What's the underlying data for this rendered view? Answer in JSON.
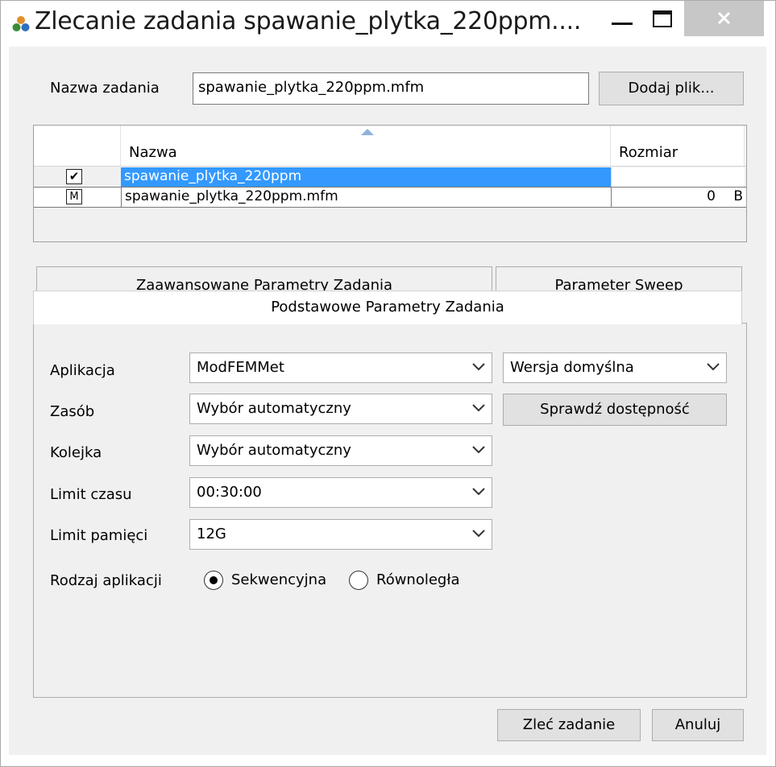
{
  "window": {
    "title": "Zlecanie zadania spawanie_plytka_220ppm....",
    "icon": "app-flower-icon",
    "controls": [
      "minimize-icon",
      "maximize-icon",
      "close-icon"
    ]
  },
  "job": {
    "name_label": "Nazwa zadania",
    "name_value": "spawanie_plytka_220ppm.mfm",
    "add_file_label": "Dodaj plik..."
  },
  "files": {
    "columns": {
      "name": "Nazwa",
      "size": "Rozmiar"
    },
    "sort_indicator": "sort-ascending-icon",
    "rows": [
      {
        "icon": "checkbox-checked-icon",
        "mark": "✔",
        "name": "spawanie_plytka_220ppm",
        "size": "",
        "unit": "",
        "selected": true
      },
      {
        "icon": "mfm-file-icon",
        "mark": "M",
        "name": "spawanie_plytka_220ppm.mfm",
        "size": "0",
        "unit": "B",
        "selected": false
      }
    ]
  },
  "tabs": {
    "advanced": "Zaawansowane Parametry Zadania",
    "sweep": "Parameter Sweep",
    "basic": "Podstawowe Parametry Zadania"
  },
  "form": {
    "application_label": "Aplikacja",
    "application_value": "ModFEMMet",
    "version_value": "Wersja domyślna",
    "resource_label": "Zasób",
    "resource_value": "Wybór automatyczny",
    "check_availability_label": "Sprawdź dostępność",
    "queue_label": "Kolejka",
    "queue_value": "Wybór automatyczny",
    "time_limit_label": "Limit czasu",
    "time_limit_value": "00:30:00",
    "memory_limit_label": "Limit pamięci",
    "memory_limit_value": "12G",
    "app_type_label": "Rodzaj aplikacji",
    "sequential_label": "Sekwencyjna",
    "parallel_label": "Równoległa",
    "selected_app_type": "Sekwencyjna"
  },
  "footer": {
    "submit_label": "Zleć zadanie",
    "cancel_label": "Anuluj"
  }
}
